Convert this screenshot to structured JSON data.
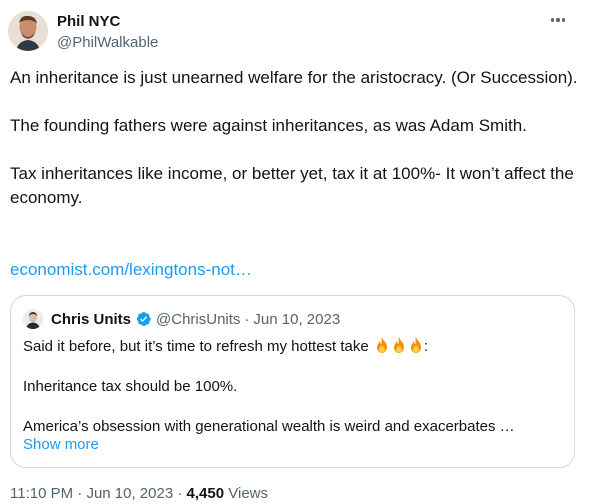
{
  "author": {
    "name": "Phil NYC",
    "handle": "@PhilWalkable"
  },
  "tweet": {
    "paragraphs": [
      "An inheritance is just unearned welfare for the aristocracy. (Or Succession).",
      "The founding fathers were against inheritances, as was Adam Smith.",
      "Tax inheritances like income, or better yet, tax it at 100%- It won’t affect the economy."
    ],
    "link": "economist.com/lexingtons-not…"
  },
  "quote": {
    "name": "Chris Units",
    "handle": "@ChrisUnits",
    "separator": "·",
    "date": "Jun 10, 2023",
    "line1": "Said it before, but it’s time to refresh my hottest take",
    "line1_suffix": ":",
    "line2": "Inheritance tax should be 100%.",
    "line3": "America’s obsession with generational wealth is weird and exacerbates …",
    "show_more": "Show more",
    "emoji": [
      "fire-icon",
      "fire-icon",
      "fire-icon"
    ]
  },
  "meta": {
    "time": "11:10 PM",
    "date": "Jun 10, 2023",
    "separator": "·",
    "views_count": "4,450",
    "views_label": "Views"
  },
  "colors": {
    "link": "#1d9bf0",
    "secondary_text": "#536471",
    "primary_text": "#0f1419",
    "border": "#cfd9de",
    "verified_badge": "#1d9bf0"
  }
}
